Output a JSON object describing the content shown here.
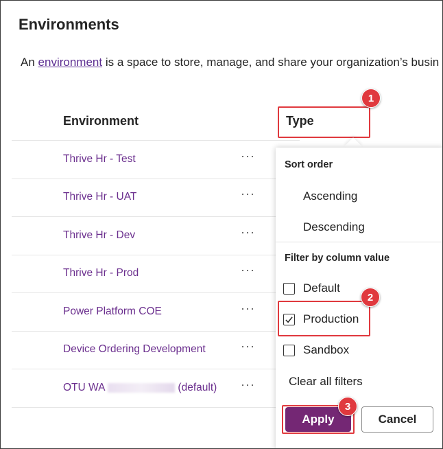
{
  "page": {
    "title": "Environments",
    "desc_prefix": "An ",
    "desc_link": "environment",
    "desc_suffix": " is a space to store, manage, and share your organization’s busin"
  },
  "table": {
    "col_environment": "Environment",
    "col_type": "Type",
    "more_glyph": "···",
    "rows": [
      {
        "name": "Thrive Hr - Test"
      },
      {
        "name": "Thrive Hr - UAT"
      },
      {
        "name": "Thrive Hr - Dev"
      },
      {
        "name": "Thrive Hr - Prod"
      },
      {
        "name": "Power Platform COE"
      },
      {
        "name": "Device Ordering Development"
      },
      {
        "name": "OTU WA",
        "suffix": "(default)"
      }
    ]
  },
  "panel": {
    "sort_heading": "Sort order",
    "sort_asc": "Ascending",
    "sort_desc": "Descending",
    "filter_heading": "Filter by column value",
    "filters": [
      {
        "label": "Default",
        "checked": false
      },
      {
        "label": "Production",
        "checked": true
      },
      {
        "label": "Sandbox",
        "checked": false
      }
    ],
    "clear_label": "Clear all filters",
    "apply_label": "Apply",
    "cancel_label": "Cancel"
  },
  "callouts": [
    "1",
    "2",
    "3"
  ],
  "colors": {
    "accent": "#742774",
    "link": "#6b2f8e",
    "callout": "#e0393e"
  }
}
